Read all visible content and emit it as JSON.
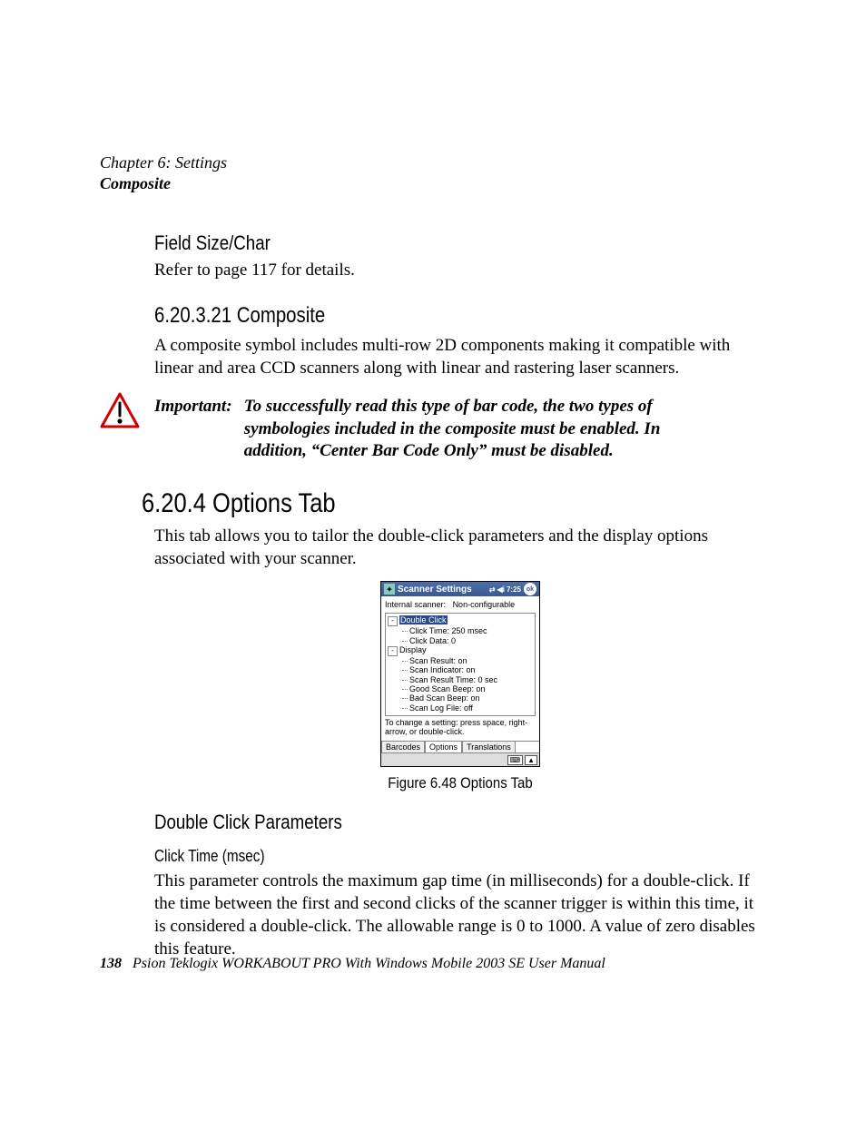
{
  "runningHead": {
    "line1": "Chapter 6: Settings",
    "line2": "Composite"
  },
  "section1": {
    "heading": "Field Size/Char",
    "body": "Refer to page 117 for details."
  },
  "section2": {
    "heading": "6.20.3.21  Composite",
    "body": "A composite symbol includes multi-row 2D components making it compatible with linear and area CCD scanners along with linear and rastering laser scanners."
  },
  "important": {
    "label": "Important:",
    "body": "To successfully read this type of bar code, the two types of symbologies included in the composite must be enabled. In addition, “Center Bar Code Only” must be disabled."
  },
  "section3": {
    "heading": "6.20.4  Options Tab",
    "body": "This tab allows you to tailor the double-click parameters and the display options associated with your scanner."
  },
  "figure": {
    "caption": "Figure 6.48 Options Tab",
    "titlebar": {
      "title": "Scanner Settings",
      "time": "7:25",
      "ok": "ok"
    },
    "statusLabel": "Internal scanner:",
    "statusValue": "Non-configurable",
    "tree": {
      "node1": "Double Click",
      "leaf1a": "Click Time: 250 msec",
      "leaf1b": "Click Data: 0",
      "node2": "Display",
      "leaf2a": "Scan Result: on",
      "leaf2b": "Scan Indicator: on",
      "leaf2c": "Scan Result Time: 0 sec",
      "leaf2d": "Good Scan Beep: on",
      "leaf2e": "Bad Scan Beep: on",
      "leaf2f": "Scan Log File: off"
    },
    "hint": "To change a setting: press space, right-arrow, or double-click.",
    "tabs": {
      "barcodes": "Barcodes",
      "options": "Options",
      "translations": "Translations"
    }
  },
  "section4": {
    "heading": "Double Click Parameters",
    "subheading": "Click Time (msec)",
    "body": "This parameter controls the maximum gap time (in milliseconds) for a double-click. If the time between the first and second clicks of the scanner trigger is within this time, it is considered a double-click. The allowable range is 0 to 1000. A value of zero disables this feature."
  },
  "footer": {
    "page": "138",
    "text": "Psion Teklogix WORKABOUT PRO With Windows Mobile 2003 SE User Manual"
  }
}
